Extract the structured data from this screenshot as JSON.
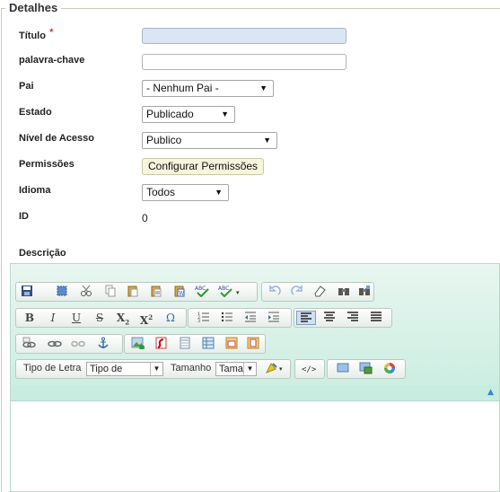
{
  "fieldset": {
    "legend": "Detalhes"
  },
  "form": {
    "titulo": {
      "label": "Título",
      "required": "*",
      "value": ""
    },
    "palavra": {
      "label": "palavra-chave",
      "value": ""
    },
    "pai": {
      "label": "Pai",
      "selected": "- Nenhum Pai -"
    },
    "estado": {
      "label": "Estado",
      "selected": "Publicado"
    },
    "nivel": {
      "label": "Nível de Acesso",
      "selected": "Publico"
    },
    "permissoes": {
      "label": "Permissões",
      "button": "Configurar Permissões"
    },
    "idioma": {
      "label": "Idioma",
      "selected": "Todos"
    },
    "id": {
      "label": "ID",
      "value": "0"
    },
    "descricao": {
      "label": "Descrição"
    }
  },
  "toolbar": {
    "font_label": "Tipo de Letra",
    "font_value": "Tipo de",
    "size_label": "Tamanho",
    "size_value": "Tama",
    "bold": "B",
    "italic": "I",
    "underline": "U",
    "strike": "S",
    "subscript": "X",
    "subscript_mark": "2",
    "superscript": "X",
    "superscript_mark": "2",
    "omega": "Ω"
  },
  "colors": {
    "accent_required": "#dd0000",
    "editor_bg": "#cdeee2",
    "perm_button_bg": "#f7f5dc"
  }
}
